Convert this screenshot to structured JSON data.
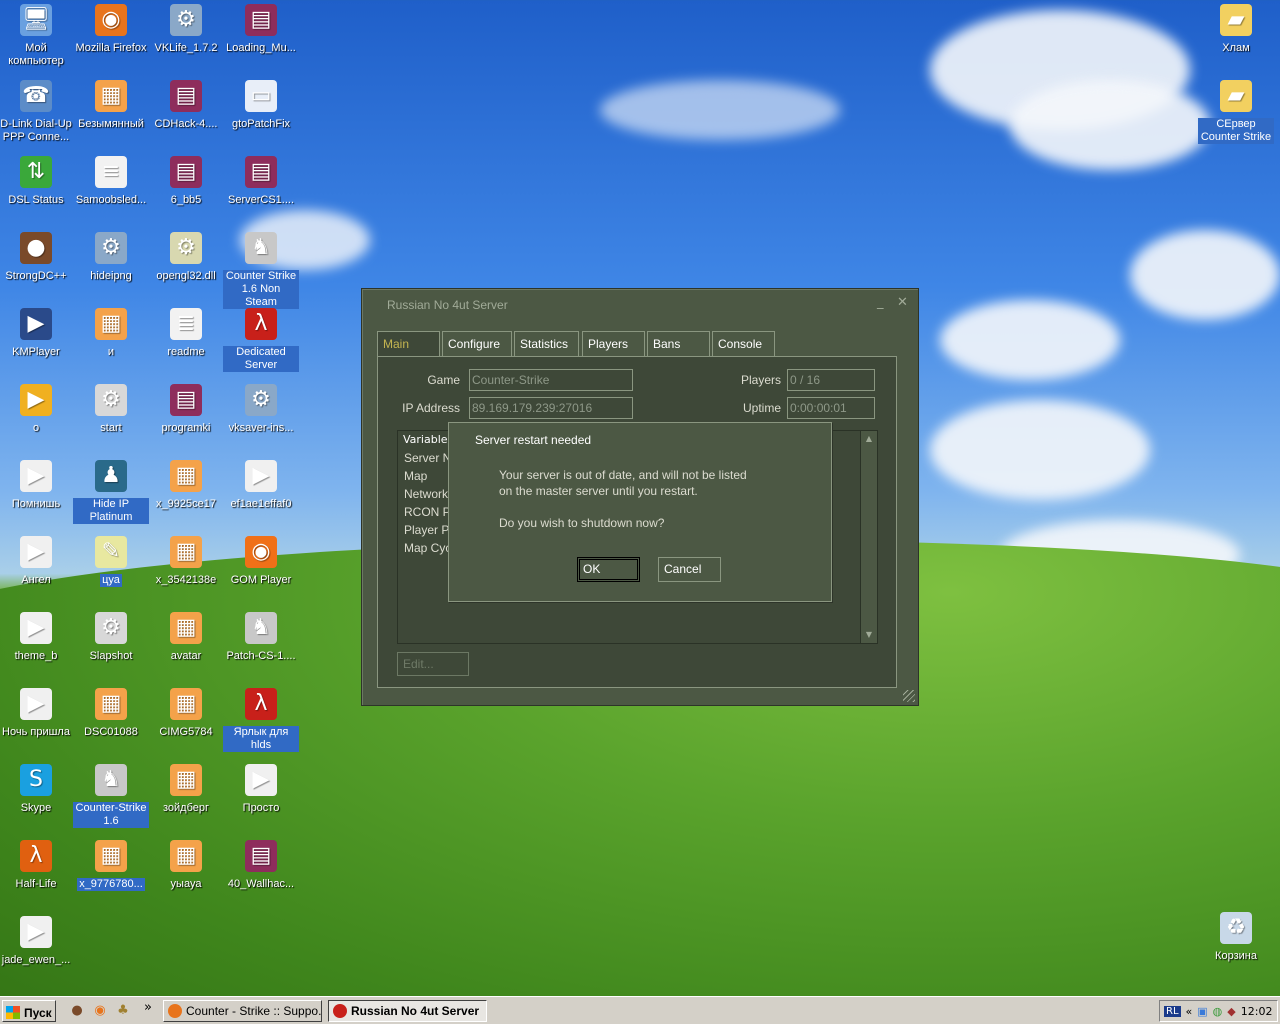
{
  "desktop": {
    "icons": [
      {
        "label": "Мой компьютер",
        "icon": "computer-icon",
        "color": "#6aa0e0"
      },
      {
        "label": "Mozilla Firefox",
        "icon": "firefox-icon",
        "color": "#e8741c"
      },
      {
        "label": "VKLife_1.7.2",
        "icon": "installer-icon",
        "color": "#8aa8c8"
      },
      {
        "label": "Loading_Mu...",
        "icon": "winrar-icon",
        "color": "#8e2d5c"
      },
      {
        "label": "D-Link Dial-Up PPP Conne...",
        "icon": "network-icon",
        "color": "#5c8cc8"
      },
      {
        "label": "Безымянный",
        "icon": "image-file-icon",
        "color": "#f4a24a"
      },
      {
        "label": "CDHack-4....",
        "icon": "winrar-icon",
        "color": "#8e2d5c"
      },
      {
        "label": "gtoPatchFix",
        "icon": "exe-window-icon",
        "color": "#e8eef8"
      },
      {
        "label": "DSL Status",
        "icon": "arrows-icon",
        "color": "#3aa83a"
      },
      {
        "label": "Samoobsled...",
        "icon": "document-icon",
        "color": "#f2f2f2"
      },
      {
        "label": "6_bb5",
        "icon": "winrar-icon",
        "color": "#8e2d5c"
      },
      {
        "label": "ServerCS1....",
        "icon": "winrar-icon",
        "color": "#8e2d5c"
      },
      {
        "label": "StrongDC++",
        "icon": "strongdc-icon",
        "color": "#7a4a2a"
      },
      {
        "label": "hideipng",
        "icon": "installer-icon",
        "color": "#8aa8c8"
      },
      {
        "label": "opengl32.dll",
        "icon": "dll-icon",
        "color": "#d8d8b0"
      },
      {
        "label": "Counter Strike 1.6 Non Steam",
        "icon": "counter-strike-icon",
        "color": "#c8c8c8"
      },
      {
        "label": "KMPlayer",
        "icon": "kmplayer-icon",
        "color": "#2a4a8a"
      },
      {
        "label": "и",
        "icon": "image-file-icon",
        "color": "#f4a24a"
      },
      {
        "label": "readme",
        "icon": "text-file-icon",
        "color": "#f2f2f2"
      },
      {
        "label": "Dedicated Server",
        "icon": "half-life-icon",
        "color": "#c8201a"
      },
      {
        "label": "o",
        "icon": "avi-icon",
        "color": "#f0b020"
      },
      {
        "label": "start",
        "icon": "batch-icon",
        "color": "#d8d8d8"
      },
      {
        "label": "programki",
        "icon": "winrar-icon",
        "color": "#8e2d5c"
      },
      {
        "label": "vksaver-ins...",
        "icon": "installer-icon",
        "color": "#8aa8c8"
      },
      {
        "label": "Помнишь",
        "icon": "media-file-icon",
        "color": "#f0f0f0"
      },
      {
        "label": "Hide IP Platinum",
        "icon": "hideip-icon",
        "color": "#2a6a8a"
      },
      {
        "label": "x_9925ce17",
        "icon": "image-file-icon",
        "color": "#f4a24a"
      },
      {
        "label": "ef1ae1effaf0",
        "icon": "media-file-icon",
        "color": "#f0f0f0"
      },
      {
        "label": "Ангел",
        "icon": "media-file-icon",
        "color": "#f0f0f0"
      },
      {
        "label": "цуа",
        "icon": "paint-icon",
        "color": "#e8e8a0"
      },
      {
        "label": "x_3542138e",
        "icon": "image-file-icon",
        "color": "#f4a24a"
      },
      {
        "label": "GOM Player",
        "icon": "gom-icon",
        "color": "#f07018"
      },
      {
        "label": "theme_b",
        "icon": "media-file-icon",
        "color": "#f0f0f0"
      },
      {
        "label": "Slapshot",
        "icon": "batch-icon",
        "color": "#d8d8d8"
      },
      {
        "label": "avatar",
        "icon": "image-file-icon",
        "color": "#f4a24a"
      },
      {
        "label": "Patch-CS-1....",
        "icon": "counter-strike-icon",
        "color": "#c8c8c8"
      },
      {
        "label": "Ночь пришла",
        "icon": "media-file-icon",
        "color": "#f0f0f0"
      },
      {
        "label": "DSC01088",
        "icon": "image-file-icon",
        "color": "#f4a24a"
      },
      {
        "label": "CIMG5784",
        "icon": "image-file-icon",
        "color": "#f4a24a"
      },
      {
        "label": "Ярлык для hlds",
        "icon": "half-life-icon",
        "color": "#c8201a"
      },
      {
        "label": "Skype",
        "icon": "skype-icon",
        "color": "#1aa0e0"
      },
      {
        "label": "Counter-Strike 1.6",
        "icon": "counter-strike-icon",
        "color": "#c8c8c8"
      },
      {
        "label": "зойдберг",
        "icon": "image-file-icon",
        "color": "#f4a24a"
      },
      {
        "label": "Просто",
        "icon": "media-file-icon",
        "color": "#f0f0f0"
      },
      {
        "label": "Half-Life",
        "icon": "half-life-icon",
        "color": "#e06010"
      },
      {
        "label": "x_9776780...",
        "icon": "image-file-icon",
        "color": "#f4a24a"
      },
      {
        "label": "уыауа",
        "icon": "image-file-icon",
        "color": "#f4a24a"
      },
      {
        "label": "40_Wallhac...",
        "icon": "winrar-icon",
        "color": "#8e2d5c"
      },
      {
        "label": "jade_ewen_...",
        "icon": "media-file-icon",
        "color": "#f0f0f0"
      }
    ],
    "right_icons": [
      {
        "label": "Хлам",
        "icon": "folder-icon",
        "color": "#f2d060"
      },
      {
        "label": "СЕрвер Counter Strike",
        "icon": "folder-icon",
        "color": "#f2d060"
      },
      {
        "label": "Корзина",
        "icon": "recycle-bin-icon",
        "color": "#c8d8e8"
      }
    ]
  },
  "server_window": {
    "title": "Russian No 4ut Server",
    "minimize": "_",
    "close": "✕",
    "tabs": [
      "Main",
      "Configure",
      "Statistics",
      "Players",
      "Bans",
      "Console"
    ],
    "active_tab": "Main",
    "game_label": "Game",
    "game_value": "Counter-Strike",
    "ip_label": "IP Address",
    "ip_value": "89.169.179.239:27016",
    "players_label": "Players",
    "players_value": "0 / 16",
    "uptime_label": "Uptime",
    "uptime_value": "0:00:00:01",
    "list_header": "Variable",
    "list_rows": [
      "Server N",
      "Map",
      "Network",
      "RCON Pa",
      "Player P",
      "Map Cyc"
    ],
    "edit_button": "Edit..."
  },
  "dialog": {
    "title": "Server restart needed",
    "message_line1": "Your server is out of date, and will not be listed",
    "message_line2": "on the master server until you restart.",
    "question": "Do you wish to shutdown now?",
    "ok": "OK",
    "cancel": "Cancel"
  },
  "taskbar": {
    "start_label": "Пуск",
    "more": "»",
    "tasks": [
      {
        "label": "Counter - Strike :: Suppo...",
        "active": false,
        "icon": "firefox-icon",
        "color": "#e8741c"
      },
      {
        "label": "Russian No 4ut Server",
        "active": true,
        "icon": "half-life-icon",
        "color": "#c8201a"
      }
    ],
    "language": "RL",
    "tray_expand": "«",
    "clock": "12:02"
  },
  "colors": {
    "window_bg": "#4c5844",
    "active_tab_text": "#c4b550",
    "selection": "#316ac5"
  }
}
